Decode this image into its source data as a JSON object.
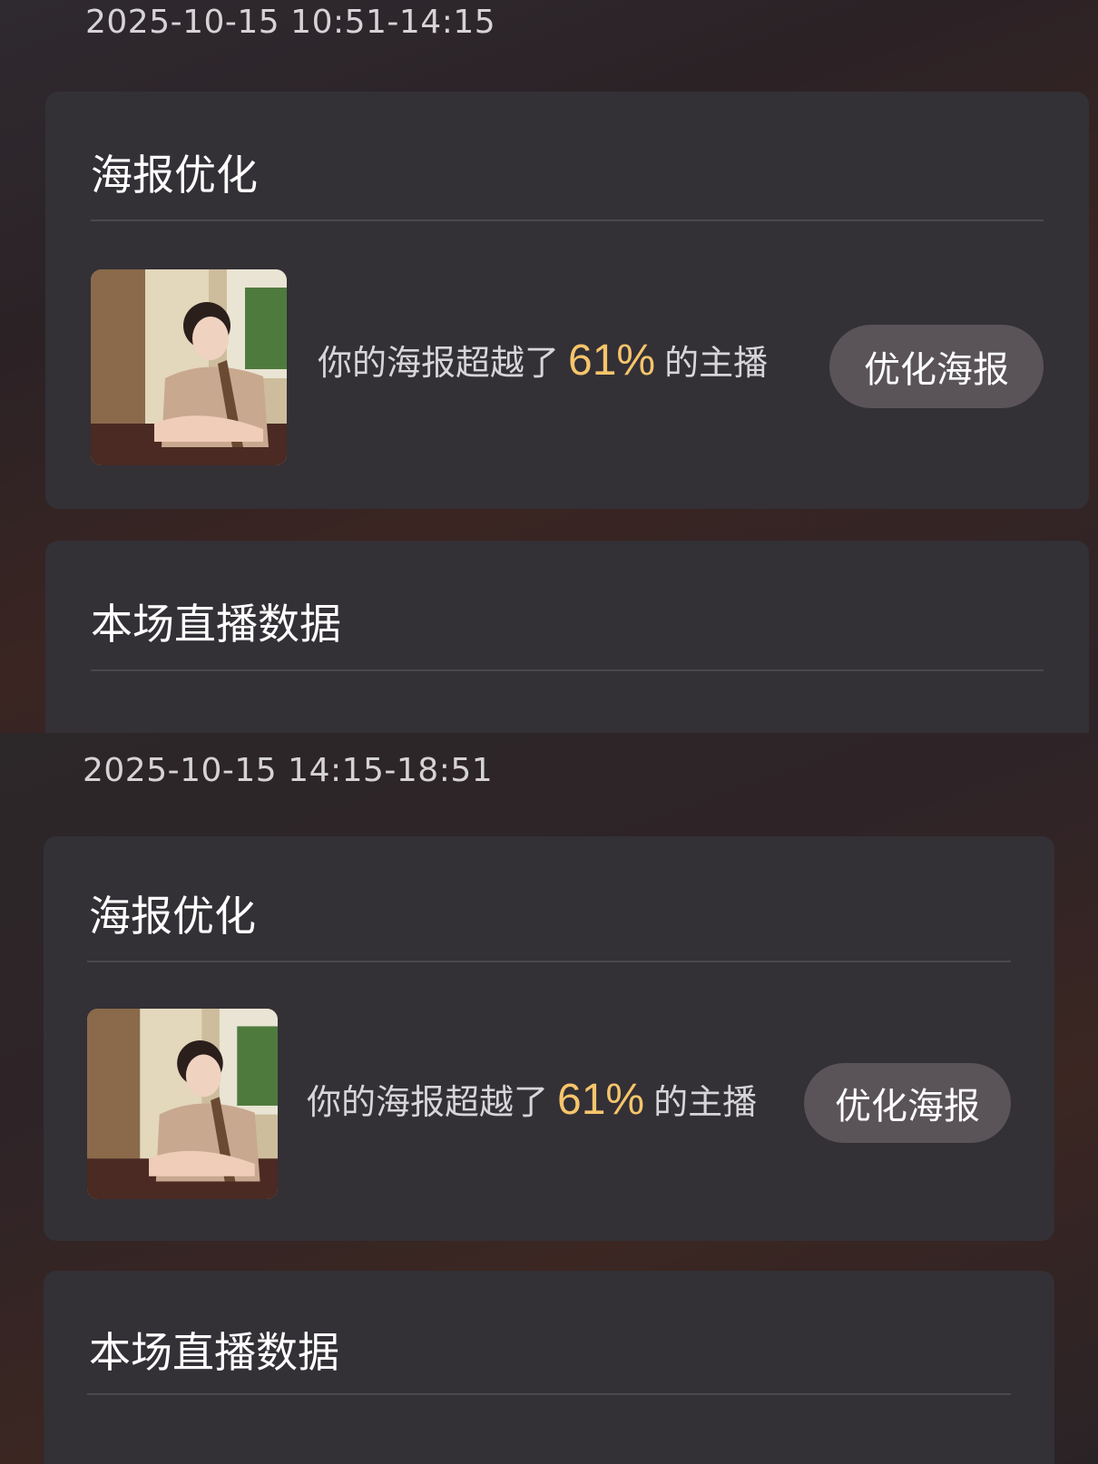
{
  "sessions": [
    {
      "time_range": "2025-10-15 10:51-14:15",
      "poster_section": {
        "title": "海报优化",
        "rank_prefix": "你的海报超越了",
        "rank_percent": "61%",
        "rank_suffix": "的主播",
        "button_label": "优化海报"
      },
      "data_section": {
        "title": "本场直播数据"
      }
    },
    {
      "time_range": "2025-10-15 14:15-18:51",
      "poster_section": {
        "title": "海报优化",
        "rank_prefix": "你的海报超越了",
        "rank_percent": "61%",
        "rank_suffix": "的主播",
        "button_label": "优化海报"
      },
      "data_section": {
        "title": "本场直播数据"
      }
    }
  ],
  "colors": {
    "highlight": "#f6c56b",
    "card": "#333036",
    "button": "#5a5459"
  }
}
